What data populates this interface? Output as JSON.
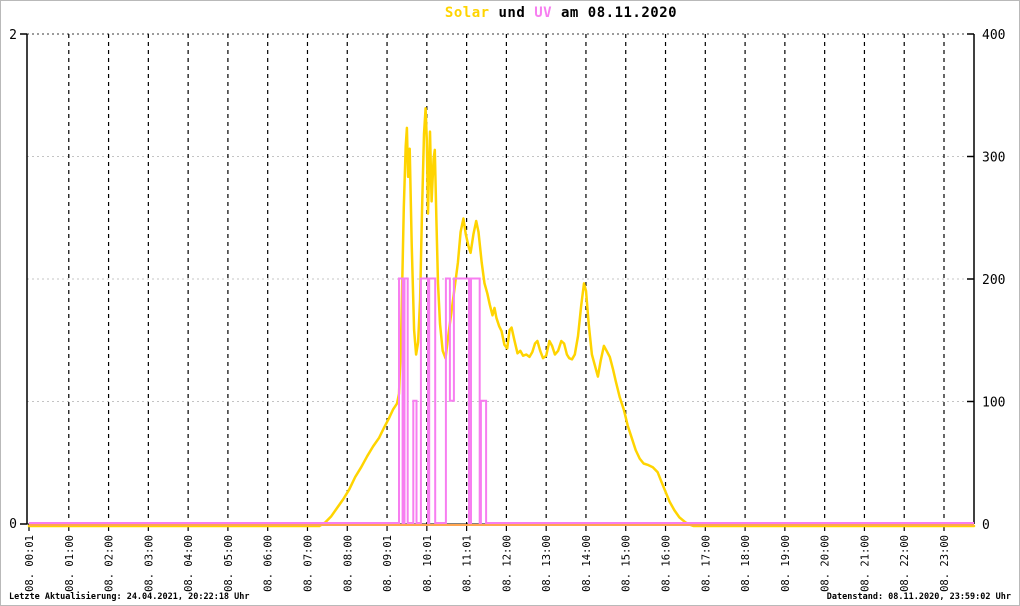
{
  "window": {
    "background": "#ffffff",
    "border_color": "#b9b9b9"
  },
  "title": {
    "full_text": "Solar und UV am 08.11.2020",
    "segments": [
      {
        "text": "Solar",
        "color": "#ffd400"
      },
      {
        "text": " und ",
        "color": "#000000"
      },
      {
        "text": "UV",
        "color": "#f77ef0"
      },
      {
        "text": " am 08.11.2020",
        "color": "#000000"
      }
    ]
  },
  "footer": {
    "left": "Letzte Aktualisierung: 24.04.2021, 20:22:18 Uhr",
    "right": "Datenstand: 08.11.2020, 23:59:02 Uhr"
  },
  "chart_data": {
    "type": "line",
    "title": "Solar und UV am 08.11.2020",
    "x_axis": {
      "unit": "time",
      "range_hours": [
        0,
        24
      ],
      "tick_labels": [
        "08. 00:01",
        "08. 01:00",
        "08. 02:00",
        "08. 03:00",
        "08. 04:00",
        "08. 05:00",
        "08. 06:00",
        "08. 07:00",
        "08. 08:00",
        "08. 09:01",
        "08. 10:01",
        "08. 11:01",
        "08. 12:00",
        "08. 13:00",
        "08. 14:00",
        "08. 15:00",
        "08. 16:00",
        "08. 17:00",
        "08. 18:00",
        "08. 19:00",
        "08. 20:00",
        "08. 21:00",
        "08. 22:00",
        "08. 23:00"
      ]
    },
    "y_axis_left": {
      "name": "UV",
      "range": [
        0,
        2
      ],
      "ticks": [
        0,
        2
      ],
      "tick_labels": [
        "0",
        "2"
      ]
    },
    "y_axis_right": {
      "name": "Solar",
      "range": [
        0,
        400
      ],
      "ticks": [
        0,
        100,
        200,
        300,
        400
      ],
      "tick_labels": [
        "0",
        "100",
        "200",
        "300",
        "400"
      ]
    },
    "grid": {
      "vertical_hourly_dashed_color": "#000000",
      "horizontal_dotted_color": "#c4c4c4",
      "horizontal_top_dotted_color": "#3a3a3a",
      "horizontal_lines_right_axis": [
        100,
        200,
        300,
        400
      ]
    },
    "legend_position": "none (colors in title)",
    "series": [
      {
        "name": "Solar",
        "axis": "right",
        "color": "#ffd400",
        "type": "line",
        "points": [
          [
            0,
            0
          ],
          [
            7.3,
            0
          ],
          [
            7.45,
            3
          ],
          [
            7.6,
            8
          ],
          [
            7.75,
            15
          ],
          [
            7.9,
            22
          ],
          [
            8.05,
            30
          ],
          [
            8.2,
            40
          ],
          [
            8.35,
            48
          ],
          [
            8.5,
            57
          ],
          [
            8.65,
            65
          ],
          [
            8.8,
            72
          ],
          [
            8.92,
            80
          ],
          [
            9.05,
            88
          ],
          [
            9.15,
            95
          ],
          [
            9.25,
            100
          ],
          [
            9.3,
            108
          ],
          [
            9.35,
            150
          ],
          [
            9.42,
            260
          ],
          [
            9.47,
            310
          ],
          [
            9.5,
            325
          ],
          [
            9.53,
            285
          ],
          [
            9.57,
            308
          ],
          [
            9.62,
            230
          ],
          [
            9.68,
            160
          ],
          [
            9.73,
            140
          ],
          [
            9.78,
            150
          ],
          [
            9.83,
            185
          ],
          [
            9.88,
            260
          ],
          [
            9.93,
            320
          ],
          [
            9.97,
            341
          ],
          [
            10.0,
            315
          ],
          [
            10.03,
            255
          ],
          [
            10.08,
            322
          ],
          [
            10.12,
            265
          ],
          [
            10.17,
            300
          ],
          [
            10.2,
            307
          ],
          [
            10.24,
            250
          ],
          [
            10.28,
            198
          ],
          [
            10.33,
            165
          ],
          [
            10.4,
            143
          ],
          [
            10.47,
            137
          ],
          [
            10.55,
            158
          ],
          [
            10.62,
            175
          ],
          [
            10.7,
            195
          ],
          [
            10.78,
            215
          ],
          [
            10.85,
            240
          ],
          [
            10.92,
            251
          ],
          [
            10.98,
            238
          ],
          [
            11.05,
            228
          ],
          [
            11.1,
            223
          ],
          [
            11.17,
            238
          ],
          [
            11.24,
            249
          ],
          [
            11.3,
            240
          ],
          [
            11.38,
            215
          ],
          [
            11.45,
            198
          ],
          [
            11.52,
            190
          ],
          [
            11.58,
            181
          ],
          [
            11.65,
            172
          ],
          [
            11.7,
            178
          ],
          [
            11.75,
            170
          ],
          [
            11.82,
            163
          ],
          [
            11.88,
            159
          ],
          [
            11.95,
            148
          ],
          [
            12.02,
            145
          ],
          [
            12.08,
            160
          ],
          [
            12.13,
            162
          ],
          [
            12.2,
            152
          ],
          [
            12.28,
            141
          ],
          [
            12.35,
            143
          ],
          [
            12.42,
            139
          ],
          [
            12.5,
            140
          ],
          [
            12.58,
            138
          ],
          [
            12.65,
            142
          ],
          [
            12.72,
            149
          ],
          [
            12.78,
            151
          ],
          [
            12.85,
            143
          ],
          [
            12.92,
            137
          ],
          [
            13.0,
            139
          ],
          [
            13.08,
            151
          ],
          [
            13.15,
            147
          ],
          [
            13.22,
            140
          ],
          [
            13.3,
            143
          ],
          [
            13.38,
            151
          ],
          [
            13.45,
            149
          ],
          [
            13.52,
            140
          ],
          [
            13.58,
            137
          ],
          [
            13.65,
            136
          ],
          [
            13.72,
            140
          ],
          [
            13.8,
            155
          ],
          [
            13.88,
            180
          ],
          [
            13.95,
            198
          ],
          [
            14.0,
            192
          ],
          [
            14.07,
            165
          ],
          [
            14.15,
            140
          ],
          [
            14.25,
            128
          ],
          [
            14.3,
            122
          ],
          [
            14.37,
            135
          ],
          [
            14.45,
            147
          ],
          [
            14.52,
            143
          ],
          [
            14.6,
            138
          ],
          [
            14.68,
            128
          ],
          [
            14.75,
            118
          ],
          [
            14.85,
            105
          ],
          [
            14.95,
            95
          ],
          [
            15.05,
            82
          ],
          [
            15.15,
            72
          ],
          [
            15.25,
            62
          ],
          [
            15.35,
            55
          ],
          [
            15.45,
            51
          ],
          [
            15.55,
            50
          ],
          [
            15.68,
            48
          ],
          [
            15.8,
            44
          ],
          [
            15.9,
            36
          ],
          [
            16.0,
            28
          ],
          [
            16.1,
            20
          ],
          [
            16.22,
            13
          ],
          [
            16.35,
            7
          ],
          [
            16.5,
            3
          ],
          [
            16.62,
            1
          ],
          [
            16.7,
            0
          ],
          [
            24,
            0
          ]
        ]
      },
      {
        "name": "UV",
        "axis": "left",
        "color": "#f77ef0",
        "type": "step",
        "baseline_value": 0,
        "segments": [
          [
            9.3,
            9.39,
            1
          ],
          [
            9.44,
            9.52,
            1
          ],
          [
            9.66,
            9.74,
            0.5
          ],
          [
            9.85,
            10.03,
            1
          ],
          [
            10.06,
            10.21,
            1
          ],
          [
            10.48,
            10.58,
            1
          ],
          [
            10.58,
            10.68,
            0.5
          ],
          [
            10.68,
            11.06,
            1
          ],
          [
            11.11,
            11.33,
            1
          ],
          [
            11.36,
            11.49,
            0.5
          ]
        ]
      },
      {
        "name": "Null-Linie",
        "axis": "right",
        "color": "#ffa550",
        "type": "line",
        "points": [
          [
            0,
            0
          ],
          [
            24,
            0
          ]
        ]
      }
    ]
  }
}
